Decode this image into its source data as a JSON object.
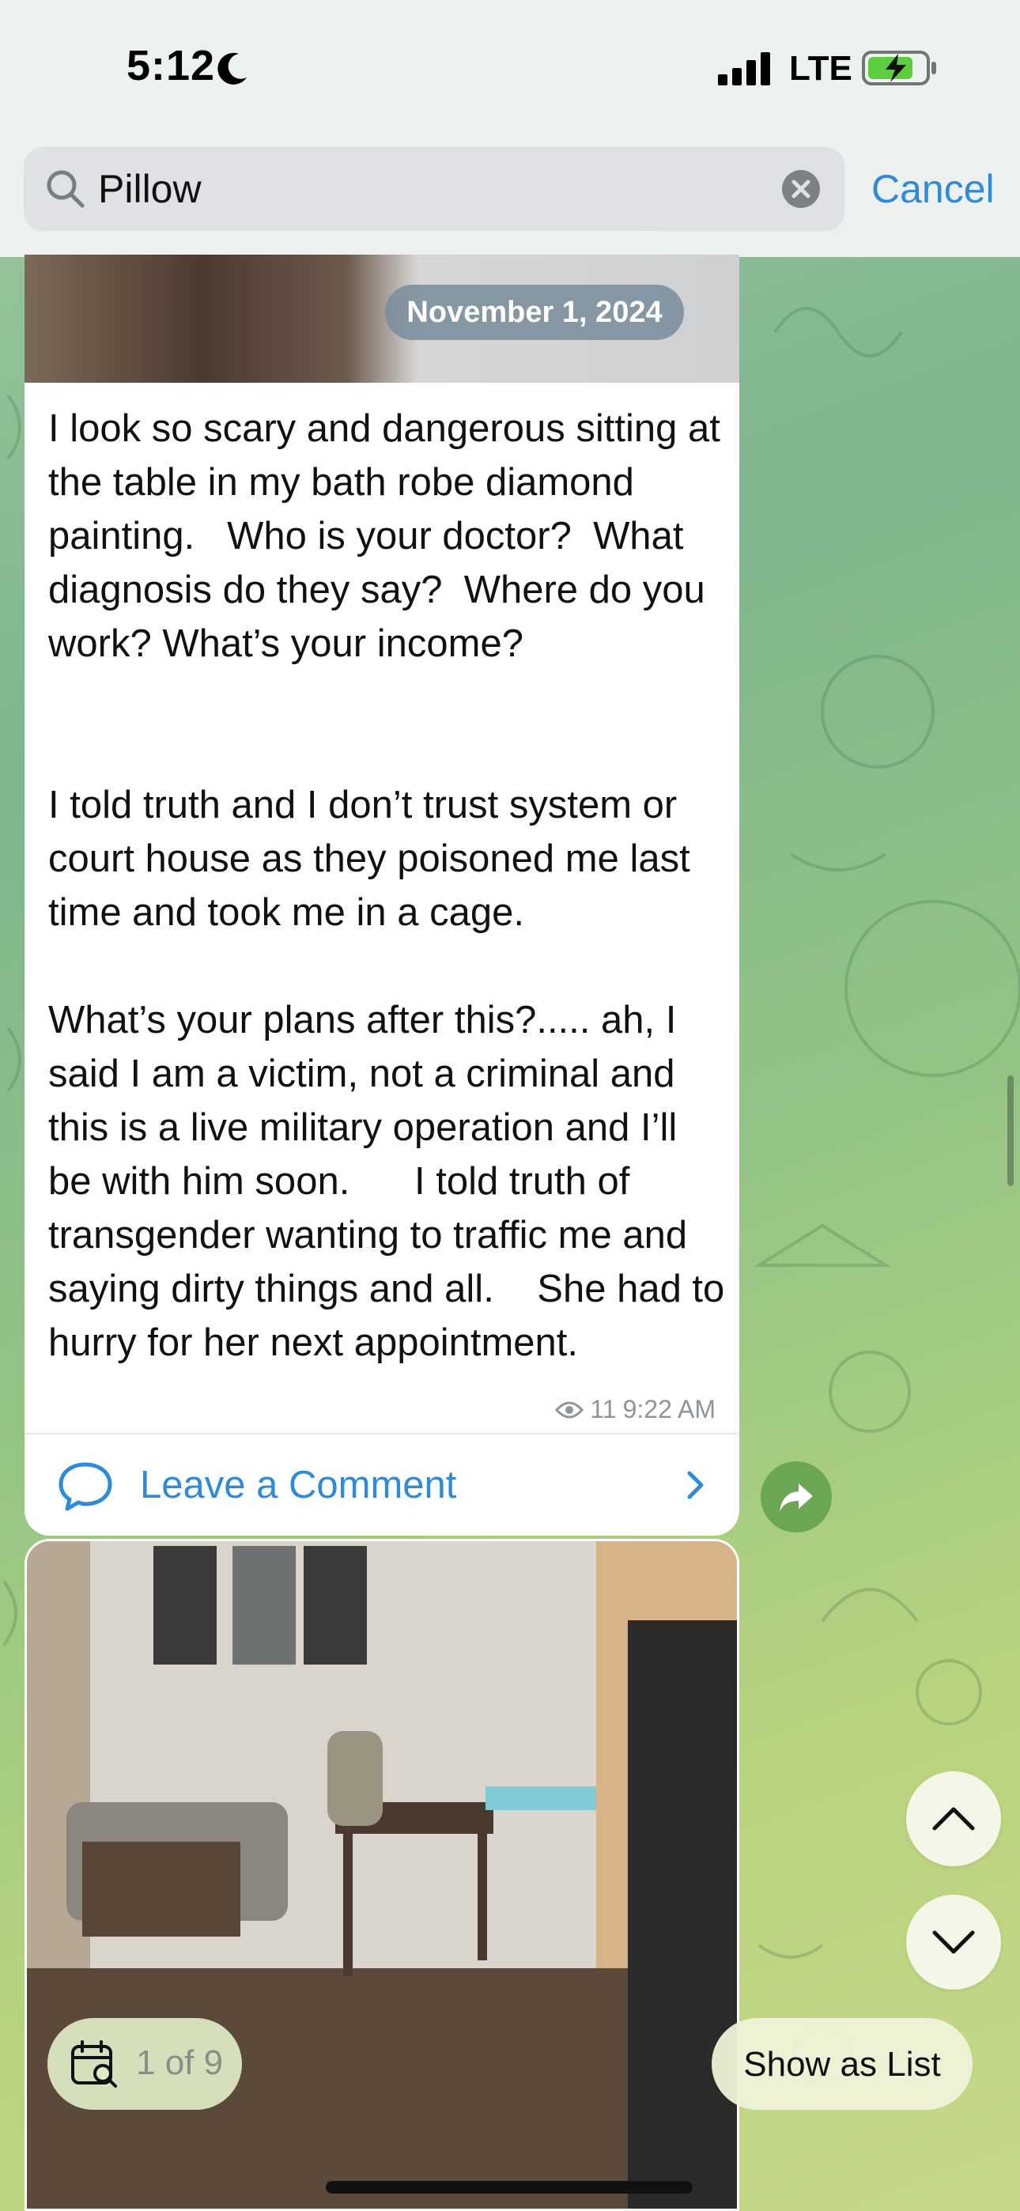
{
  "status_bar": {
    "time": "5:12",
    "network": "LTE",
    "icons": [
      "moon-icon",
      "signal-icon",
      "battery-charging-icon"
    ]
  },
  "search": {
    "query": "Pillow",
    "cancel_label": "Cancel"
  },
  "message": {
    "date_badge": "November 1, 2024",
    "text": "I look so scary and dangerous sitting at the table in my bath robe diamond painting.   Who is your doctor?  What diagnosis do they say?  Where do you work? What’s your income?\n\n\nI told truth and I don’t trust system or court house as they poisoned me last time and took me in a cage.\n\nWhat’s your plans after this?..... ah, I said I am a victim, not a criminal and this is a live military operation and I’ll be with him soon.      I told truth of transgender wanting to traffic me and saying dirty things and all.    She had to hurry for her next appointment.",
    "views": "11",
    "time": "9:22 AM",
    "comment_label": "Leave a Comment"
  },
  "results": {
    "counter": "1 of 9",
    "show_as_list_label": "Show as List"
  },
  "colors": {
    "accent": "#2f8bd8",
    "share_button": "#6aa653",
    "bubble": "#ffffff"
  }
}
